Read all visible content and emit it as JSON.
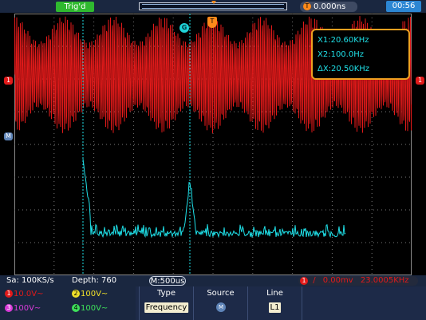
{
  "top_bar": {
    "trigger_status": "Trig'd",
    "trigger_time_icon": "T",
    "trigger_time": "0.000ns",
    "clock": "00:56"
  },
  "markers": {
    "ch1": "1",
    "math": "M",
    "g_cursor": "G",
    "trigger": "T"
  },
  "measurements": {
    "x1": "X1:20.60KHz",
    "x2": "X2:100.0Hz",
    "dx": "ΔX:20.50KHz"
  },
  "status": {
    "sample_rate": "Sa: 100KS/s",
    "depth": "Depth: 760",
    "timebase": "M:500us",
    "trigger_icon": "1",
    "trigger_slope": "/",
    "trigger_level": "0.00mv",
    "trigger_freq": "23.0005KHz"
  },
  "channels": {
    "ch1": {
      "num": "1",
      "scale": "10.0V~"
    },
    "ch2": {
      "num": "2",
      "scale": "100V~"
    },
    "ch3": {
      "num": "3",
      "scale": "100V~"
    },
    "ch4": {
      "num": "4",
      "scale": "100V~"
    }
  },
  "menu": {
    "type_label": "Type",
    "type_value": "Frequency",
    "source_label": "Source",
    "source_icon": "M",
    "line_label": "Line",
    "line_value": "L1"
  },
  "colors": {
    "ch1": "#e21a1a",
    "ch2": "#f0e02a",
    "ch3": "#d83cd8",
    "ch4": "#3ee05a",
    "math": "#1fe0e8",
    "trigger": "#ff8a1a"
  }
}
